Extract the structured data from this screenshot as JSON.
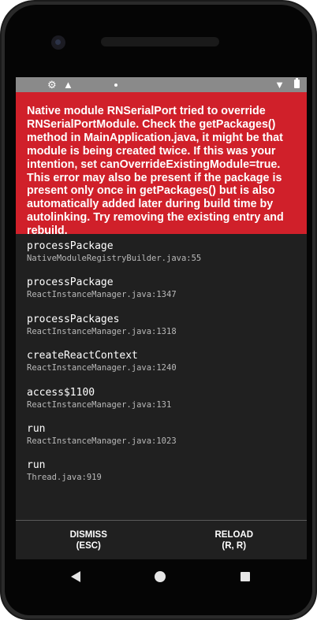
{
  "status_bar": {
    "icons": [
      "gear-icon",
      "warning-icon",
      "notification-dot-icon",
      "wifi-icon",
      "battery-icon"
    ]
  },
  "error": {
    "message": "Native module RNSerialPort tried to override RNSerialPortModule. Check the getPackages() method in MainApplication.java, it might be that module is being created twice. If this was your intention, set canOverrideExistingModule=true. This error may also be present if the package is present only once in getPackages() but is also automatically added later during build time by autolinking. Try removing the existing entry and rebuild.",
    "background_color": "#d0202a"
  },
  "stack": [
    {
      "method": "processPackage",
      "file": "NativeModuleRegistryBuilder.java:55"
    },
    {
      "method": "processPackage",
      "file": "ReactInstanceManager.java:1347"
    },
    {
      "method": "processPackages",
      "file": "ReactInstanceManager.java:1318"
    },
    {
      "method": "createReactContext",
      "file": "ReactInstanceManager.java:1240"
    },
    {
      "method": "access$1100",
      "file": "ReactInstanceManager.java:131"
    },
    {
      "method": "run",
      "file": "ReactInstanceManager.java:1023"
    },
    {
      "method": "run",
      "file": "Thread.java:919"
    }
  ],
  "footer": {
    "dismiss_label": "DISMISS\n(ESC)",
    "reload_label": "RELOAD\n(R, R)"
  },
  "nav_bar": {
    "icons": [
      "back-icon",
      "home-icon",
      "recents-icon"
    ]
  }
}
